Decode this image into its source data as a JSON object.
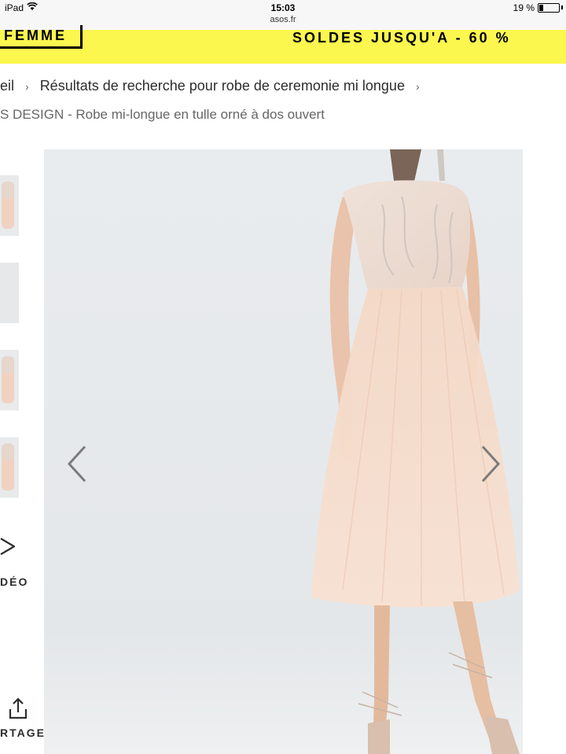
{
  "status_bar": {
    "device": "iPad",
    "time": "15:03",
    "url": "asos.fr",
    "battery": "19 %",
    "battery_level": 0.19
  },
  "promo": {
    "femme": "FEMME",
    "soldes": "SOLDES JUSQU'A - 60 %",
    "color": "#fcf74f"
  },
  "breadcrumb": {
    "items": [
      "eil",
      "Résultats de recherche pour robe de ceremonie mi longue"
    ],
    "separator": "›"
  },
  "product": {
    "title": "S DESIGN - Robe mi-longue en tulle orné à dos ouvert"
  },
  "media": {
    "video_label": "DÉO",
    "share_label": "RTAGE"
  },
  "icons": [
    "wifi-icon",
    "battery-icon",
    "play-icon",
    "share-icon",
    "chevron-left-icon",
    "chevron-right-icon"
  ]
}
